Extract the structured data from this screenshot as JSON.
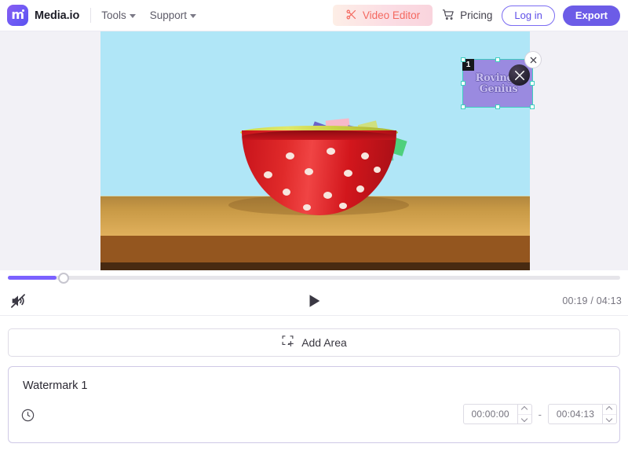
{
  "header": {
    "brand": "Media.io",
    "logo_letter": "m",
    "nav": [
      {
        "label": "Tools",
        "icon": "chevron-down-icon"
      },
      {
        "label": "Support",
        "icon": "chevron-down-icon"
      }
    ],
    "video_editor_button": {
      "label": "Video Editor",
      "icon": "scissors-icon",
      "text_color": "#f4685f"
    },
    "pricing": {
      "label": "Pricing",
      "icon": "cart-icon"
    },
    "login_button": "Log in",
    "export_button": "Export",
    "accent_color": "#6c5ce7"
  },
  "watermark_overlay": {
    "index_badge": "1",
    "text_line1": "Roving",
    "text_line2": "Genius",
    "badge_icon": "crossed-tools-icon",
    "close_icon": "close-icon",
    "selection_color": "#3ecfc0",
    "fill_color": "#9a8ae0"
  },
  "player": {
    "mute_icon": "volume-muted-icon",
    "play_icon": "play-icon",
    "time": "00:19 / 04:13",
    "current_time": "00:19",
    "duration": "04:13",
    "progress_percent": 8,
    "progress_color": "#7b61ff"
  },
  "add_area": {
    "label": "Add Area",
    "icon": "dashed-square-plus-icon"
  },
  "watermark_panel": {
    "title": "Watermark 1",
    "clock_icon": "clock-icon",
    "start_time": "00:00:00",
    "end_time": "00:04:13",
    "separator": "-",
    "spinner_up_icon": "chevron-up-icon",
    "spinner_down_icon": "chevron-down-icon"
  }
}
